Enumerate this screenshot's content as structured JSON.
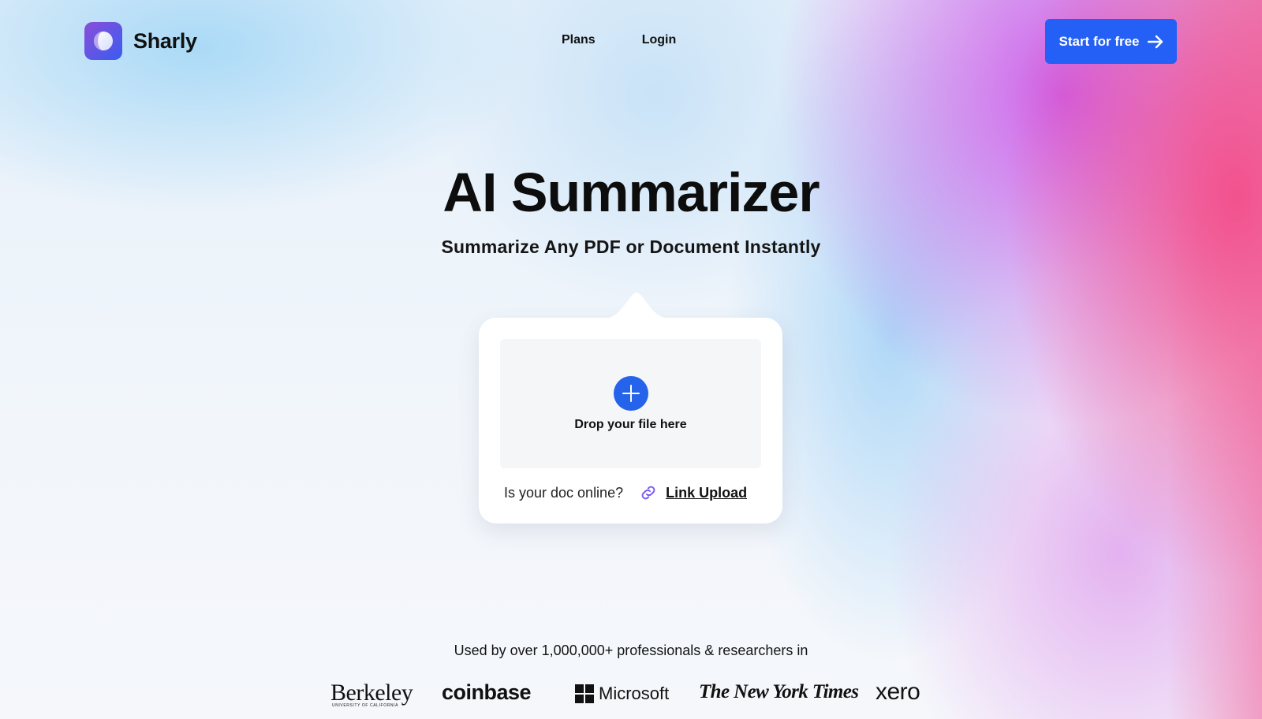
{
  "brand": {
    "name": "Sharly"
  },
  "nav": {
    "items": [
      {
        "label": "Plans"
      },
      {
        "label": "Login"
      }
    ]
  },
  "cta": {
    "label": "Start for free",
    "icon": "arrow-right-icon"
  },
  "hero": {
    "title": "AI Summarizer",
    "subtitle": "Summarize Any PDF or Document Instantly"
  },
  "upload": {
    "drop_label": "Drop your file here",
    "online_question": "Is your doc online?",
    "link_upload_label": "Link Upload",
    "icons": {
      "add": "plus-icon",
      "link": "link-icon"
    }
  },
  "social_proof": {
    "text": "Used by over 1,000,000+ professionals & researchers in",
    "logos": {
      "berkeley": "Berkeley",
      "berkeley_sub": "UNIVERSITY OF CALIFORNIA",
      "coinbase": "coinbase",
      "microsoft": "Microsoft",
      "nyt": "The New York Times",
      "xero": "xero"
    }
  },
  "colors": {
    "accent": "#2460f5",
    "link_icon": "#7b5cf0",
    "text": "#111111"
  }
}
